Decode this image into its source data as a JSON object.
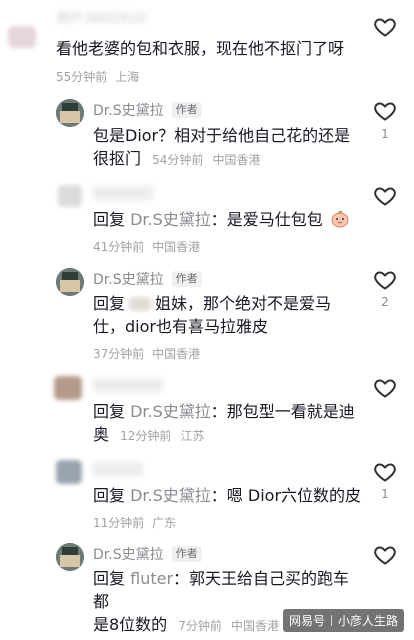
{
  "comments": [
    {
      "name": "用户3602910",
      "text": "看他老婆的包和衣服，现在他不抠门了呀",
      "time": "55分钟前",
      "loc": "上海"
    },
    {
      "name": "Dr.S史黛拉",
      "tag": "作者",
      "text_line1": "包是Dior？相对于给他自己花的还是",
      "text_line2": "很抠门",
      "time": "54分钟前",
      "loc": "中国香港",
      "likes": "1"
    },
    {
      "name": "",
      "reply_prefix": "回复",
      "reply_to": "Dr.S史黛拉",
      "text": "：是爱马仕包包",
      "time": "41分钟前",
      "loc": "中国香港"
    },
    {
      "name": "Dr.S史黛拉",
      "tag": "作者",
      "reply_prefix": "回复",
      "text_line1": "姐妹，那个绝对不是爱马",
      "text_line2": "仕，dior也有喜马拉雅皮",
      "time": "37分钟前",
      "loc": "中国香港",
      "likes": "2"
    },
    {
      "name": "",
      "reply_prefix": "回复",
      "reply_to": "Dr.S史黛拉",
      "text_line1": "：那包型一看就是迪",
      "text_line2": "奥",
      "time": "12分钟前",
      "loc": "江苏"
    },
    {
      "name": "",
      "reply_prefix": "回复",
      "reply_to": "Dr.S史黛拉",
      "text": "：嗯 Dior六位数的皮",
      "time": "11分钟前",
      "loc": "广东",
      "likes": "1"
    },
    {
      "name": "Dr.S史黛拉",
      "tag": "作者",
      "reply_prefix": "回复",
      "reply_to": "fluter",
      "text_line1": "：郭天王给自己买的跑车都",
      "text_line2": "是8位数的",
      "time": "7分钟前",
      "loc": "中国香港"
    }
  ],
  "watermark": {
    "left": "网易号",
    "right": "小彦人生路"
  }
}
